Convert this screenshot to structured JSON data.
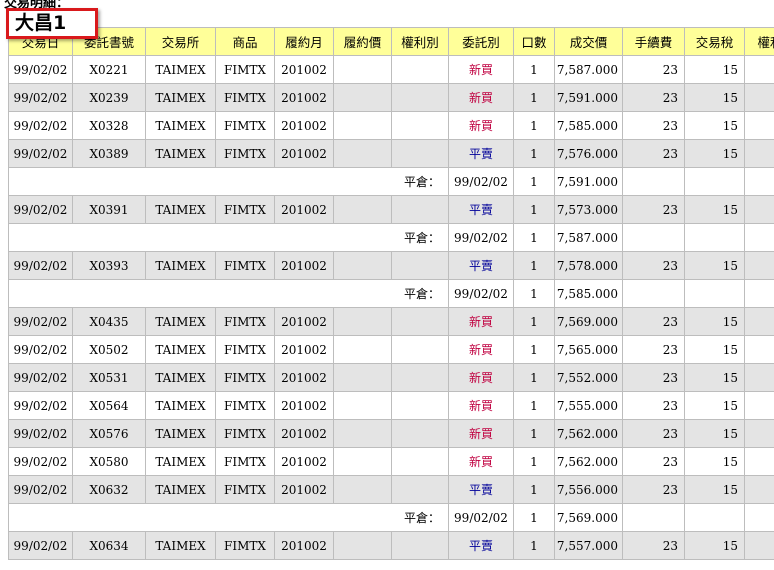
{
  "page_title": "交易明細：",
  "badge_label": "大昌1",
  "headers": [
    "交易日",
    "委託書號",
    "交易所",
    "商品",
    "履約月",
    "履約價",
    "權利別",
    "委託別",
    "口數",
    "成交價",
    "手續費",
    "交易稅",
    "權利"
  ],
  "rows": [
    {
      "type": "trade",
      "date": "99/02/02",
      "order_no": "X0221",
      "exchange": "TAIMEX",
      "product": "FIMTX",
      "month": "201002",
      "side": "新買",
      "side_kind": "buy",
      "qty": "1",
      "price": "7,587.000",
      "fee": "23",
      "tax": "15"
    },
    {
      "type": "trade",
      "date": "99/02/02",
      "order_no": "X0239",
      "exchange": "TAIMEX",
      "product": "FIMTX",
      "month": "201002",
      "side": "新買",
      "side_kind": "buy",
      "qty": "1",
      "price": "7,591.000",
      "fee": "23",
      "tax": "15"
    },
    {
      "type": "trade",
      "date": "99/02/02",
      "order_no": "X0328",
      "exchange": "TAIMEX",
      "product": "FIMTX",
      "month": "201002",
      "side": "新買",
      "side_kind": "buy",
      "qty": "1",
      "price": "7,585.000",
      "fee": "23",
      "tax": "15"
    },
    {
      "type": "trade",
      "date": "99/02/02",
      "order_no": "X0389",
      "exchange": "TAIMEX",
      "product": "FIMTX",
      "month": "201002",
      "side": "平賣",
      "side_kind": "sell",
      "qty": "1",
      "price": "7,576.000",
      "fee": "23",
      "tax": "15"
    },
    {
      "type": "close",
      "label": "平倉：",
      "date": "99/02/02",
      "qty": "1",
      "price": "7,591.000"
    },
    {
      "type": "trade",
      "date": "99/02/02",
      "order_no": "X0391",
      "exchange": "TAIMEX",
      "product": "FIMTX",
      "month": "201002",
      "side": "平賣",
      "side_kind": "sell",
      "qty": "1",
      "price": "7,573.000",
      "fee": "23",
      "tax": "15"
    },
    {
      "type": "close",
      "label": "平倉：",
      "date": "99/02/02",
      "qty": "1",
      "price": "7,587.000"
    },
    {
      "type": "trade",
      "date": "99/02/02",
      "order_no": "X0393",
      "exchange": "TAIMEX",
      "product": "FIMTX",
      "month": "201002",
      "side": "平賣",
      "side_kind": "sell",
      "qty": "1",
      "price": "7,578.000",
      "fee": "23",
      "tax": "15"
    },
    {
      "type": "close",
      "label": "平倉：",
      "date": "99/02/02",
      "qty": "1",
      "price": "7,585.000"
    },
    {
      "type": "trade",
      "date": "99/02/02",
      "order_no": "X0435",
      "exchange": "TAIMEX",
      "product": "FIMTX",
      "month": "201002",
      "side": "新買",
      "side_kind": "buy",
      "qty": "1",
      "price": "7,569.000",
      "fee": "23",
      "tax": "15"
    },
    {
      "type": "trade",
      "date": "99/02/02",
      "order_no": "X0502",
      "exchange": "TAIMEX",
      "product": "FIMTX",
      "month": "201002",
      "side": "新買",
      "side_kind": "buy",
      "qty": "1",
      "price": "7,565.000",
      "fee": "23",
      "tax": "15"
    },
    {
      "type": "trade",
      "date": "99/02/02",
      "order_no": "X0531",
      "exchange": "TAIMEX",
      "product": "FIMTX",
      "month": "201002",
      "side": "新買",
      "side_kind": "buy",
      "qty": "1",
      "price": "7,552.000",
      "fee": "23",
      "tax": "15"
    },
    {
      "type": "trade",
      "date": "99/02/02",
      "order_no": "X0564",
      "exchange": "TAIMEX",
      "product": "FIMTX",
      "month": "201002",
      "side": "新買",
      "side_kind": "buy",
      "qty": "1",
      "price": "7,555.000",
      "fee": "23",
      "tax": "15"
    },
    {
      "type": "trade",
      "date": "99/02/02",
      "order_no": "X0576",
      "exchange": "TAIMEX",
      "product": "FIMTX",
      "month": "201002",
      "side": "新買",
      "side_kind": "buy",
      "qty": "1",
      "price": "7,562.000",
      "fee": "23",
      "tax": "15"
    },
    {
      "type": "trade",
      "date": "99/02/02",
      "order_no": "X0580",
      "exchange": "TAIMEX",
      "product": "FIMTX",
      "month": "201002",
      "side": "新買",
      "side_kind": "buy",
      "qty": "1",
      "price": "7,562.000",
      "fee": "23",
      "tax": "15"
    },
    {
      "type": "trade",
      "date": "99/02/02",
      "order_no": "X0632",
      "exchange": "TAIMEX",
      "product": "FIMTX",
      "month": "201002",
      "side": "平賣",
      "side_kind": "sell",
      "qty": "1",
      "price": "7,556.000",
      "fee": "23",
      "tax": "15"
    },
    {
      "type": "close",
      "label": "平倉：",
      "date": "99/02/02",
      "qty": "1",
      "price": "7,569.000"
    },
    {
      "type": "trade",
      "date": "99/02/02",
      "order_no": "X0634",
      "exchange": "TAIMEX",
      "product": "FIMTX",
      "month": "201002",
      "side": "平賣",
      "side_kind": "sell",
      "qty": "1",
      "price": "7,557.000",
      "fee": "23",
      "tax": "15"
    }
  ],
  "colors": {
    "header_bg": "#ffff99",
    "row_alt_bg": "#e4e4e4",
    "buy_text": "#c00040",
    "sell_text": "#000099",
    "badge_border": "#d9191c"
  }
}
